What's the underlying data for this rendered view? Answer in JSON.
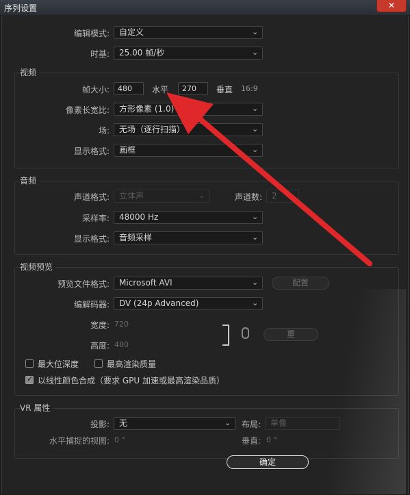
{
  "window": {
    "title": "序列设置",
    "close_icon": "✕"
  },
  "top": {
    "edit_mode_label": "编辑模式:",
    "edit_mode_value": "自定义",
    "timebase_label": "时基:",
    "timebase_value": "25.00  帧/秒"
  },
  "video": {
    "title": "视频",
    "frame_size_label": "帧大小:",
    "width_value": "480",
    "h_label": "水平",
    "height_value": "270",
    "v_label": "垂直",
    "aspect": "16:9",
    "pixel_aspect_label": "像素长宽比:",
    "pixel_aspect_value": "方形像素 (1.0)",
    "field_label": "场:",
    "field_value": "无场（逐行扫描）",
    "display_format_label": "显示格式:",
    "display_format_value": "画框"
  },
  "audio": {
    "title": "音频",
    "channel_format_label": "声道格式:",
    "channel_format_value": "立体声",
    "channel_count_label": "声道数:",
    "channel_count_value": "2",
    "sample_rate_label": "采样率:",
    "sample_rate_value": "48000 Hz",
    "display_format_label": "显示格式:",
    "display_format_value": "音频采样"
  },
  "preview": {
    "title": "视频预览",
    "file_format_label": "预览文件格式:",
    "file_format_value": "Microsoft AVI",
    "config_button": "配置",
    "codec_label": "编解码器:",
    "codec_value": "DV (24p Advanced)",
    "width_label": "宽度:",
    "width_value": "720",
    "height_label": "高度:",
    "height_value": "480",
    "reset_button": "重",
    "max_bit_depth": "最大位深度",
    "max_render_quality": "最高渲染质量",
    "linear_color": "以线性颜色合成（要求 GPU 加速或最高渲染品质）"
  },
  "vr": {
    "title": "VR 属性",
    "projection_label": "投影:",
    "projection_value": "无",
    "layout_label": "布局:",
    "layout_value": "单像",
    "h_capture_label": "水平捕捉的视图:",
    "h_capture_value": "0 °",
    "vertical_label": "垂直:",
    "vertical_value": "0 °"
  },
  "footer": {
    "ok_button": "确定"
  },
  "colors": {
    "arrow": "#e0282a",
    "accent_close": "#c7392b"
  }
}
